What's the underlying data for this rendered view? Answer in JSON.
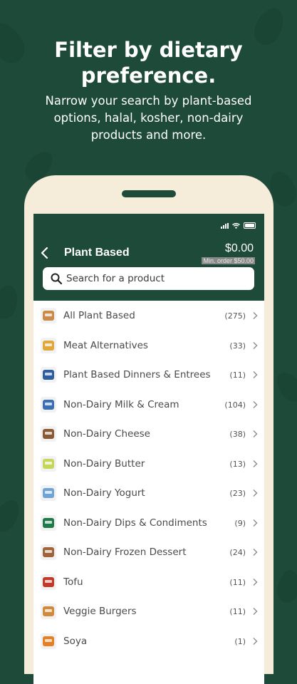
{
  "promo": {
    "headline_line1": "Filter by dietary",
    "headline_line2": "preference.",
    "sub_line1": "Narrow your search by plant-based",
    "sub_line2": "options, halal, kosher, non-dairy",
    "sub_line3": "products and more."
  },
  "app": {
    "title": "Plant Based",
    "cart_total": "$0.00",
    "min_order": "Min. order $50.00",
    "search_placeholder": "Search for a product"
  },
  "categories": [
    {
      "label": "All Plant Based",
      "count": "(275)",
      "icon": "plant-based-products-thumb",
      "color": "#c98a4a"
    },
    {
      "label": "Meat Alternatives",
      "count": "(33)",
      "icon": "meat-alternatives-thumb",
      "color": "#e0a83a"
    },
    {
      "label": "Plant Based Dinners & Entrees",
      "count": "(11)",
      "icon": "dinner-box-thumb",
      "color": "#2d5f9e"
    },
    {
      "label": "Non-Dairy Milk & Cream",
      "count": "(104)",
      "icon": "milk-carton-thumb",
      "color": "#3a6fb5"
    },
    {
      "label": "Non-Dairy Cheese",
      "count": "(38)",
      "icon": "cheese-thumb",
      "color": "#8a5a34"
    },
    {
      "label": "Non-Dairy Butter",
      "count": "(13)",
      "icon": "butter-tub-thumb",
      "color": "#c6d65a"
    },
    {
      "label": "Non-Dairy Yogurt",
      "count": "(23)",
      "icon": "yogurt-cup-thumb",
      "color": "#6fa3d6"
    },
    {
      "label": "Non-Dairy Dips & Condiments",
      "count": "(9)",
      "icon": "dip-jar-thumb",
      "color": "#1f7a4a"
    },
    {
      "label": "Non-Dairy Frozen Dessert",
      "count": "(24)",
      "icon": "frozen-dessert-thumb",
      "color": "#a0643a"
    },
    {
      "label": "Tofu",
      "count": "(11)",
      "icon": "tofu-pack-thumb",
      "color": "#c0392b"
    },
    {
      "label": "Veggie Burgers",
      "count": "(11)",
      "icon": "veggie-burger-thumb",
      "color": "#d08a3a"
    },
    {
      "label": "Soya",
      "count": "(1)",
      "icon": "soya-thumb",
      "color": "#e67e22"
    }
  ],
  "colors": {
    "brand_green": "#1e4a3a",
    "phone_frame": "#f5ecd9"
  }
}
